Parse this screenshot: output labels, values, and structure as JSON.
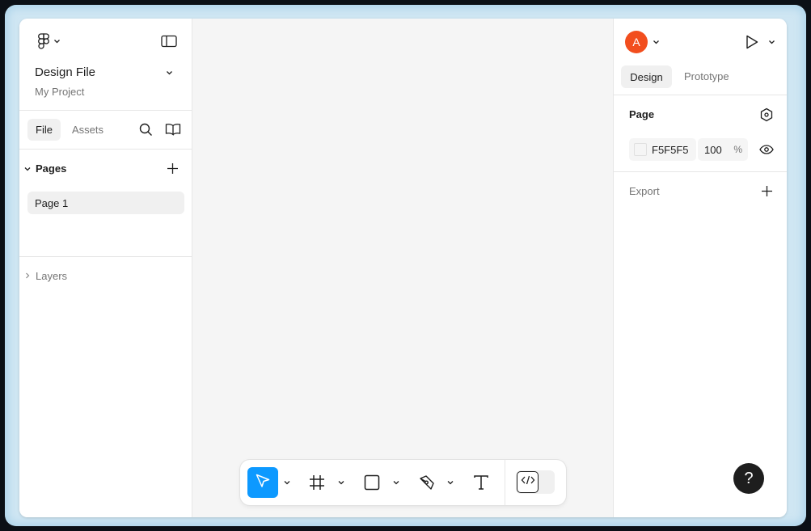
{
  "file": {
    "title": "Design File",
    "project": "My Project"
  },
  "left_tabs": {
    "file": "File",
    "assets": "Assets"
  },
  "pages": {
    "label": "Pages",
    "items": [
      {
        "label": "Page 1"
      }
    ]
  },
  "layers": {
    "label": "Layers"
  },
  "user": {
    "initial": "A",
    "avatar_color": "#f24e1e"
  },
  "right_tabs": {
    "design": "Design",
    "prototype": "Prototype"
  },
  "page_props": {
    "label": "Page",
    "background_hex": "F5F5F5",
    "opacity": "100",
    "opacity_unit": "%"
  },
  "export": {
    "label": "Export"
  },
  "help": {
    "label": "?"
  },
  "toolbar": {
    "tools": [
      "move-tool",
      "frame-tool",
      "rectangle-tool",
      "pen-tool",
      "text-tool"
    ],
    "active_tool": "move-tool",
    "dev_mode": "off"
  },
  "colors": {
    "accent": "#0d99ff",
    "canvas": "#f5f5f5",
    "panel": "#ffffff"
  }
}
